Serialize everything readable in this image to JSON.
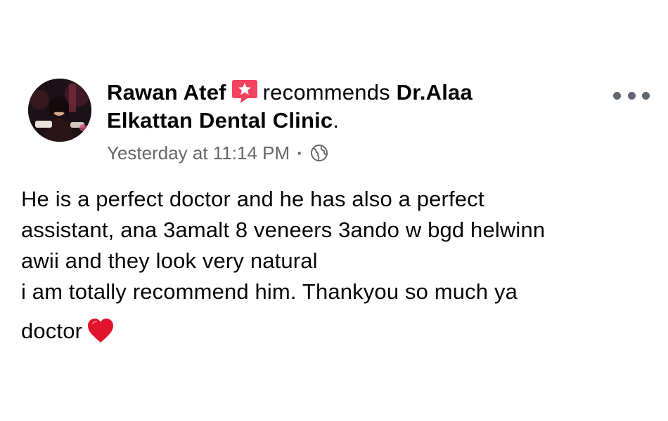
{
  "post": {
    "author_name": "Rawan Atef",
    "recommends_text": "recommends",
    "page_name_line1": "Dr.Alaa",
    "page_name_line2": "Elkattan Dental Clinic",
    "page_suffix": ".",
    "timestamp": "Yesterday at 11:14 PM",
    "meta_separator": "·",
    "privacy_icon": "globe-icon",
    "recommend_icon": "recommendation-star-icon",
    "more_icon": "more-options-icon",
    "body_lines": [
      "He is a perfect doctor and he has also a perfect",
      "assistant, ana 3amalt 8 veneers 3ando w bgd helwinn",
      "awii and they look very natural",
      "i am totally recommend him. Thankyou so much ya",
      "doctor"
    ],
    "end_emoji": "red-heart-icon"
  },
  "colors": {
    "text_primary": "#050505",
    "text_secondary": "#65676b",
    "recommend_pink": "#f3425f",
    "heart_red": "#e0142c"
  }
}
